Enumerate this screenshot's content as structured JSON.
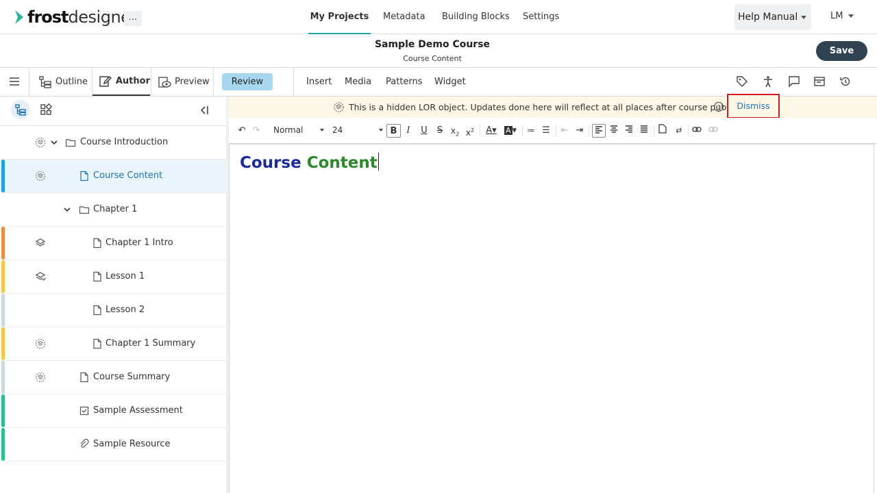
{
  "app": {
    "logo_bold": "frost",
    "logo_light": "designer",
    "more_label": "..."
  },
  "nav": {
    "items": [
      "My Projects",
      "Metadata",
      "Building Blocks",
      "Settings"
    ],
    "active": "My Projects",
    "accent_color": "#1da1a1",
    "help_label": "Help Manual",
    "user_initials": "LM"
  },
  "course": {
    "title": "Sample Demo Course",
    "subtitle": "Course Content",
    "save_label": "Save"
  },
  "modes": {
    "outline": "Outline",
    "author": "Author",
    "preview": "Preview",
    "review": "Review",
    "active": "Author"
  },
  "insert_menu": [
    "Insert",
    "Media",
    "Patterns",
    "Widget"
  ],
  "right_tools": [
    "tag-icon",
    "accessibility-icon",
    "comment-icon",
    "panel-icon",
    "history-icon"
  ],
  "banner": {
    "message": "This is a hidden LOR object. Updates done here will reflect at all places after course publish.",
    "dismiss_label": "Dismiss",
    "highlight_color": "#d71920"
  },
  "format": {
    "block_style": "Normal",
    "font_size": "24"
  },
  "tree": [
    {
      "label": "Course Introduction",
      "type": "folder",
      "status": "hidden",
      "expanded": true,
      "bar": "",
      "selected": false
    },
    {
      "label": "Course Content",
      "type": "page",
      "status": "hidden",
      "bar": "#1da1e0",
      "selected": true
    },
    {
      "label": "Chapter 1",
      "type": "folder",
      "status": "",
      "expanded": true,
      "bar": "",
      "selected": false
    },
    {
      "label": "Chapter 1 Intro",
      "type": "page",
      "status": "layers",
      "bar": "#f08a3c",
      "selected": false
    },
    {
      "label": "Lesson 1",
      "type": "page",
      "status": "layers-check",
      "bar": "#f5c842",
      "selected": false
    },
    {
      "label": "Lesson 2",
      "type": "page",
      "status": "",
      "bar": "#c9d9dc",
      "selected": false
    },
    {
      "label": "Chapter 1 Summary",
      "type": "page",
      "status": "hidden",
      "bar": "#f5c842",
      "selected": false
    },
    {
      "label": "Course Summary",
      "type": "page",
      "status": "hidden",
      "bar": "#c9d9dc",
      "selected": false
    },
    {
      "label": "Sample Assessment",
      "type": "assessment",
      "status": "",
      "bar": "#2bbf8f",
      "selected": false
    },
    {
      "label": "Sample Resource",
      "type": "resource",
      "status": "",
      "bar": "#2bbf8f",
      "selected": false
    }
  ],
  "editor": {
    "heading_word1": "Course",
    "heading_word2": "Content",
    "word1_color": "#1b2a9a",
    "word2_color": "#2a8a2a"
  }
}
